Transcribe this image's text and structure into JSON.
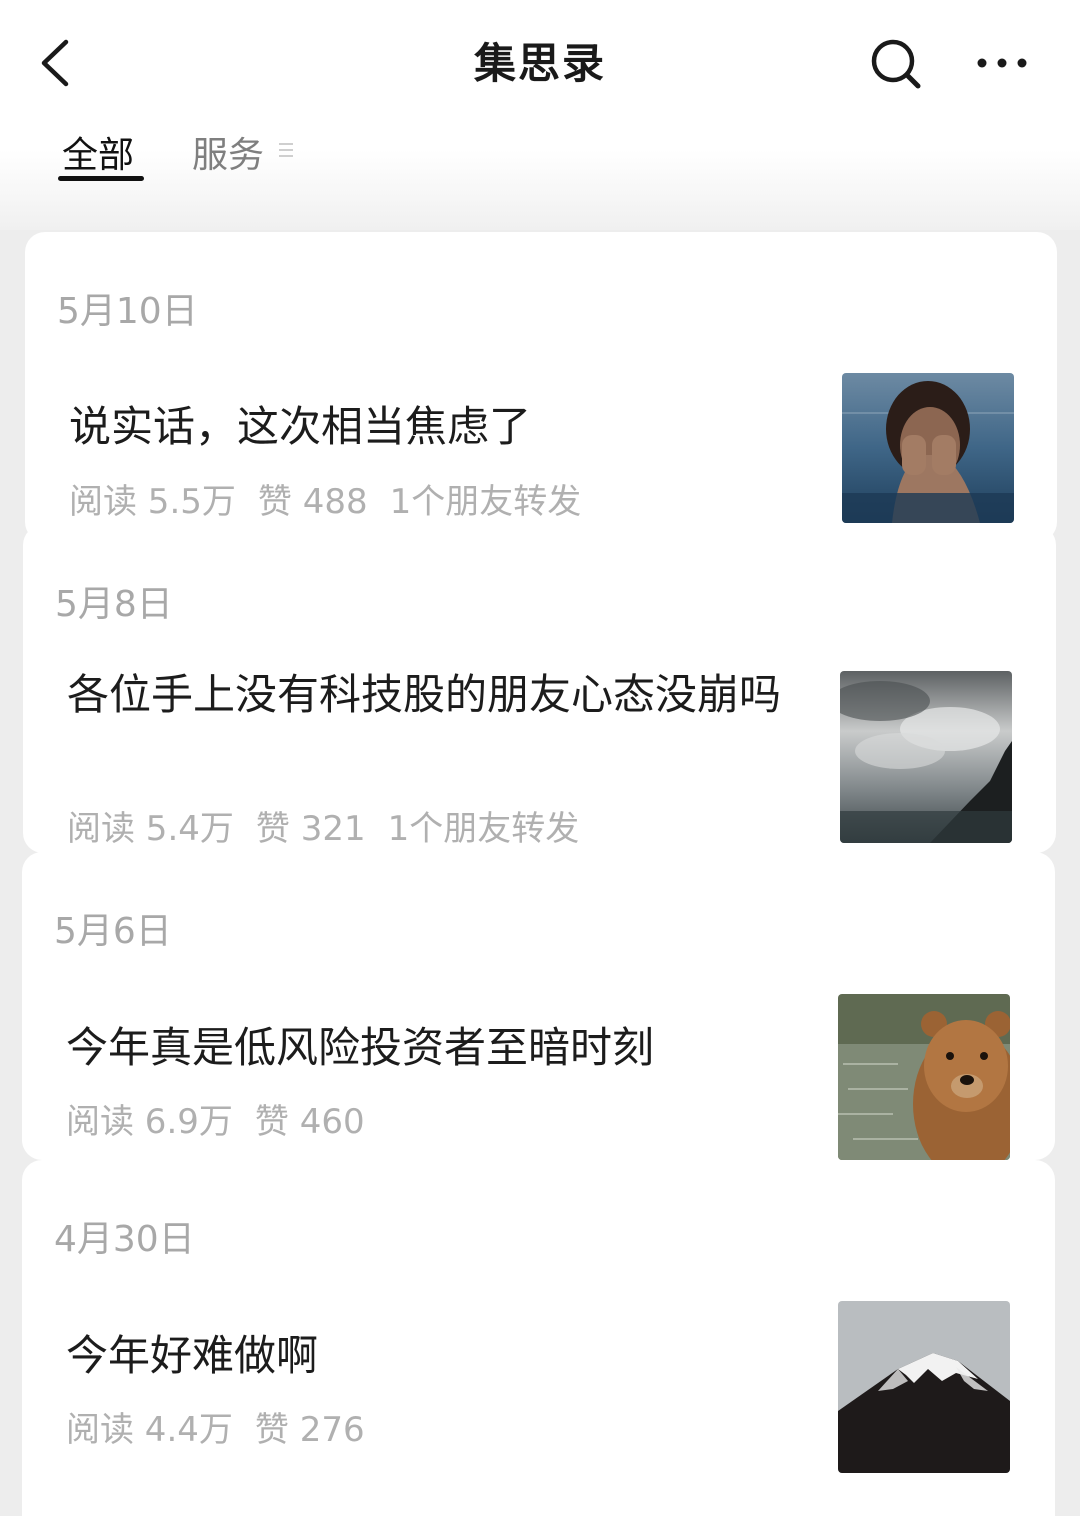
{
  "header": {
    "title": "集思录"
  },
  "tabs": [
    {
      "label": "全部",
      "active": true
    },
    {
      "label": "服务",
      "active": false
    }
  ],
  "articles": [
    {
      "date": "5月10日",
      "title": "说实话，这次相当焦虑了",
      "reads": "阅读 5.5万",
      "likes": "赞 488",
      "shares": "1个朋友转发",
      "thumbnail": "woman-in-water-covering-face"
    },
    {
      "date": "5月8日",
      "title": "各位手上没有科技股的朋友心态没崩吗",
      "reads": "阅读 5.4万",
      "likes": "赞 321",
      "shares": "1个朋友转发",
      "thumbnail": "cloudy-sky-mountain-silhouette"
    },
    {
      "date": "5月6日",
      "title": "今年真是低风险投资者至暗时刻",
      "reads": "阅读 6.9万",
      "likes": "赞 460",
      "shares": "",
      "thumbnail": "brown-bear-in-water"
    },
    {
      "date": "4月30日",
      "title": "今年好难做啊",
      "reads": "阅读 4.4万",
      "likes": "赞 276",
      "shares": "",
      "thumbnail": "snowy-mountain-peak"
    }
  ]
}
